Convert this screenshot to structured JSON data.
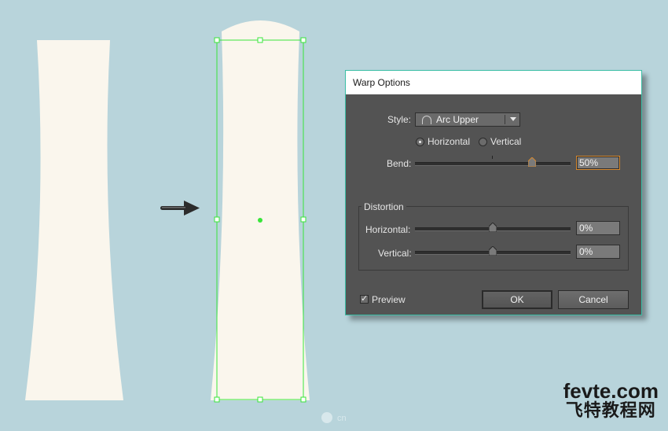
{
  "dialog": {
    "title": "Warp Options",
    "style_label": "Style:",
    "style_value": "Arc Upper",
    "orientation": {
      "horizontal_label": "Horizontal",
      "vertical_label": "Vertical",
      "selected": "Horizontal"
    },
    "bend": {
      "label": "Bend:",
      "value": "50%",
      "fraction": 0.75
    },
    "distortion": {
      "group_label": "Distortion",
      "horizontal": {
        "label": "Horizontal:",
        "value": "0%",
        "fraction": 0.5
      },
      "vertical": {
        "label": "Vertical:",
        "value": "0%",
        "fraction": 0.5
      }
    },
    "preview_label": "Preview",
    "preview_checked": true,
    "ok_label": "OK",
    "cancel_label": "Cancel"
  },
  "watermark": {
    "line1": "fevte.com",
    "line2": "飞特教程网",
    "small": "cn"
  },
  "colors": {
    "background": "#b8d4db",
    "shape_fill": "#faf6ed",
    "selection": "#39e53a",
    "dialog_bg": "#535353",
    "focus_border": "#d6892f"
  },
  "icons": [
    "arrow-right-icon",
    "arc-upper-icon",
    "chevron-down-icon",
    "checkmark-icon"
  ]
}
